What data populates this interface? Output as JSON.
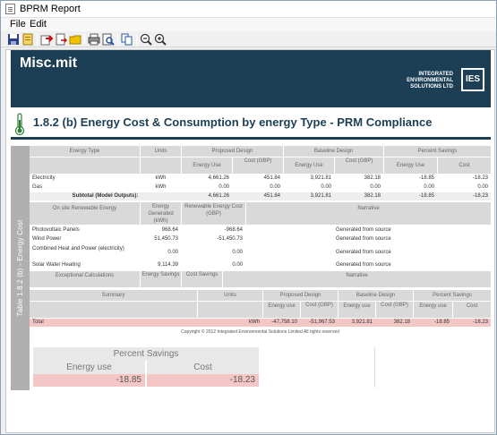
{
  "window": {
    "title": "BPRM Report"
  },
  "menu": {
    "file": "File",
    "edit": "Edit"
  },
  "toolbar": {
    "icons": [
      "save-icon",
      "open-icon",
      "export-red-icon",
      "export-icon",
      "folder-icon",
      "print-icon",
      "print-preview-icon",
      "copy-icon",
      "zoom-out-icon",
      "zoom-in-icon"
    ]
  },
  "banner": {
    "project": "Misc.mit",
    "company_line1": "INTEGRATED",
    "company_line2": "ENVIRONMENTAL",
    "company_line3": "SOLUTIONS LTD",
    "logo": "IES",
    "background": "#1c3f55"
  },
  "report": {
    "title": "1.8.2 (b) Energy Cost & Consumption by energy Type - PRM Compliance",
    "side_tab": "Table 1.8.2 (b) - Energy Cost"
  },
  "main_table": {
    "headers": {
      "energy_type": "Energy Type",
      "units": "Units",
      "proposed": "Proposed Design",
      "baseline": "Baseline Design",
      "percent": "Percent Savings",
      "energy_use": "Energy Use",
      "cost_gbp": "Cost (GBP)",
      "energy": "Energy",
      "cost": "Cost"
    },
    "rows": [
      {
        "type": "Electricity",
        "units": "kWh",
        "p_use": "4,661.26",
        "p_cost": "451.84",
        "b_use": "3,921.81",
        "b_cost": "382.18",
        "s_use": "-18.85",
        "s_cost": "-18.23"
      },
      {
        "type": "Gas",
        "units": "kWh",
        "p_use": "0.00",
        "p_cost": "0.00",
        "b_use": "0.00",
        "b_cost": "0.00",
        "s_use": "0.00",
        "s_cost": "0.00"
      }
    ],
    "subtotal": {
      "label": "Subtotal (Model Outputs):",
      "p_use": "4,661.26",
      "p_cost": "451.84",
      "b_use": "3,921.81",
      "b_cost": "382.18",
      "s_use": "-18.85",
      "s_cost": "-18.23"
    }
  },
  "renewable": {
    "headers": {
      "onsite": "On site Renewable Energy",
      "generated": "Energy Generated (kWh)",
      "cost": "Renewable Energy Cost (GBP)",
      "narrative": "Narrative"
    },
    "rows": [
      {
        "name": "Photovoltaic Panels",
        "gen": "968.64",
        "cost": "-968.64",
        "narrative": "Generated from source"
      },
      {
        "name": "Wind Power",
        "gen": "51,450.73",
        "cost": "-51,450.73",
        "narrative": "Generated from source"
      },
      {
        "name": "Combined Heat and Power (electricity)",
        "gen": "0.00",
        "cost": "0.00",
        "narrative": "Generated from source"
      },
      {
        "name": "Solar Water Heating",
        "gen": "9,114.39",
        "cost": "0.00",
        "narrative": "Generated from source"
      }
    ]
  },
  "exceptional": {
    "headers": {
      "calc": "Exceptional Calculations",
      "savings": "Energy Savings",
      "cost": "Cost Savings",
      "narrative": "Narrative"
    }
  },
  "summary": {
    "headers": {
      "summary": "Summary",
      "units": "Units",
      "proposed": "Proposed Design",
      "baseline": "Baseline Design",
      "percent": "Percent Savings",
      "energy_use": "Energy use",
      "cost_gbp": "Cost (GBP)",
      "cost": "Cost"
    },
    "total": {
      "label": "Total",
      "units": "kWh",
      "p_use": "-47,758.10",
      "p_cost": "-51,967.53",
      "b_use": "3,921.81",
      "b_cost": "382.18",
      "s_use": "-18.85",
      "s_cost": "-18.23"
    },
    "copyright": "Copyright © 2012 Integrated Environmental Solutions Limited All rights reserved"
  },
  "percent_box": {
    "title": "Percent Savings",
    "energy_label": "Energy use",
    "cost_label": "Cost",
    "energy_value": "-18.85",
    "cost_value": "-18.23"
  }
}
